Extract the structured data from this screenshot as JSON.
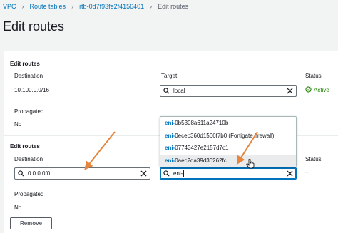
{
  "breadcrumb": {
    "items": [
      "VPC",
      "Route tables",
      "rtb-0d7f93fe2f4156401"
    ],
    "current": "Edit routes",
    "separator": "›"
  },
  "page_title": "Edit routes",
  "route1": {
    "section_title": "Edit routes",
    "destination_label": "Destination",
    "destination_value": "10.100.0.0/16",
    "target_label": "Target",
    "target_value": "local",
    "status_label": "Status",
    "status_value": "Active",
    "propagated_label": "Propagated",
    "propagated_value": "No"
  },
  "route2": {
    "section_title": "Edit routes",
    "destination_label": "Destination",
    "destination_value": "0.0.0.0/0",
    "target_value": "eni-",
    "status_label": "Status",
    "status_value": "–",
    "propagated_label": "Propagated",
    "propagated_value": "No",
    "remove_label": "Remove"
  },
  "dropdown": {
    "options": [
      {
        "prefix": "eni-",
        "rest": "0b5308a611a24710b"
      },
      {
        "prefix": "eni-",
        "rest": "0eceb360d1566f7b0 (Fortigate firewall)"
      },
      {
        "prefix": "eni-",
        "rest": "07743427e2157d7c1"
      },
      {
        "prefix": "eni-",
        "rest": "0aec2da39d30262fc"
      }
    ],
    "highlighted_index": 3
  },
  "colors": {
    "link": "#0073bb",
    "status_active": "#1d8102",
    "annotation_arrow": "#e8853d"
  },
  "icons": [
    "search-icon",
    "clear-icon",
    "status-active-icon",
    "hand-cursor-icon"
  ]
}
